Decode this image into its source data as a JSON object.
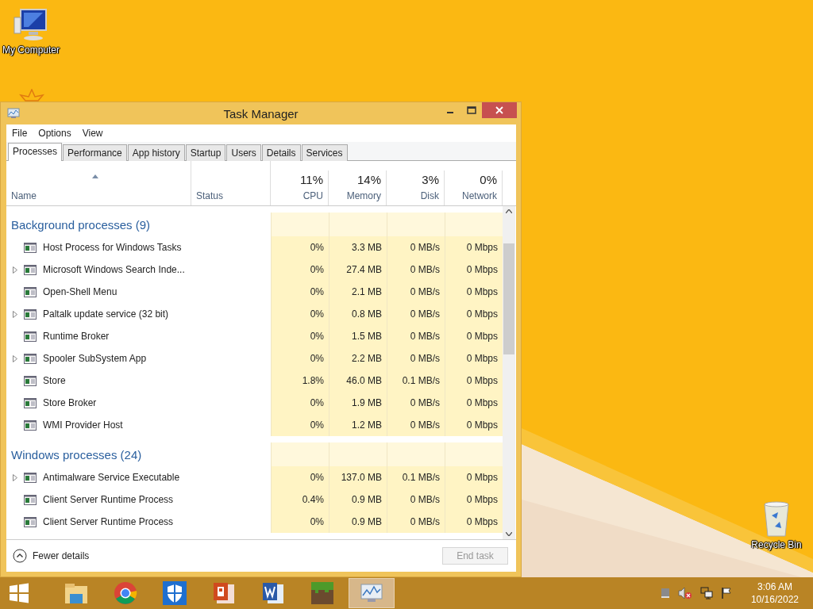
{
  "desktop_icons": [
    {
      "label": "My Computer"
    },
    {
      "label": "Recycle Bin"
    }
  ],
  "window": {
    "title": "Task Manager",
    "menu": [
      "File",
      "Options",
      "View"
    ],
    "tabs": [
      {
        "label": "Processes",
        "selected": true
      },
      {
        "label": "Performance",
        "selected": false
      },
      {
        "label": "App history",
        "selected": false
      },
      {
        "label": "Startup",
        "selected": false
      },
      {
        "label": "Users",
        "selected": false
      },
      {
        "label": "Details",
        "selected": false
      },
      {
        "label": "Services",
        "selected": false
      }
    ],
    "columns": {
      "name": "Name",
      "status": "Status",
      "metrics": [
        {
          "percent": "11%",
          "label": "CPU"
        },
        {
          "percent": "14%",
          "label": "Memory"
        },
        {
          "percent": "3%",
          "label": "Disk"
        },
        {
          "percent": "0%",
          "label": "Network"
        }
      ]
    },
    "groups": [
      {
        "title": "Background processes (9)",
        "rows": [
          {
            "name": "Host Process for Windows Tasks",
            "expandable": false,
            "values": [
              "0%",
              "3.3 MB",
              "0 MB/s",
              "0 Mbps"
            ]
          },
          {
            "name": "Microsoft Windows Search Inde...",
            "expandable": true,
            "values": [
              "0%",
              "27.4 MB",
              "0 MB/s",
              "0 Mbps"
            ]
          },
          {
            "name": "Open-Shell Menu",
            "expandable": false,
            "values": [
              "0%",
              "2.1 MB",
              "0 MB/s",
              "0 Mbps"
            ]
          },
          {
            "name": "Paltalk update service (32 bit)",
            "expandable": true,
            "values": [
              "0%",
              "0.8 MB",
              "0 MB/s",
              "0 Mbps"
            ]
          },
          {
            "name": "Runtime Broker",
            "expandable": false,
            "values": [
              "0%",
              "1.5 MB",
              "0 MB/s",
              "0 Mbps"
            ]
          },
          {
            "name": "Spooler SubSystem App",
            "expandable": true,
            "values": [
              "0%",
              "2.2 MB",
              "0 MB/s",
              "0 Mbps"
            ]
          },
          {
            "name": "Store",
            "expandable": false,
            "values": [
              "1.8%",
              "46.0 MB",
              "0.1 MB/s",
              "0 Mbps"
            ]
          },
          {
            "name": "Store Broker",
            "expandable": false,
            "values": [
              "0%",
              "1.9 MB",
              "0 MB/s",
              "0 Mbps"
            ]
          },
          {
            "name": "WMI Provider Host",
            "expandable": false,
            "values": [
              "0%",
              "1.2 MB",
              "0 MB/s",
              "0 Mbps"
            ]
          }
        ]
      },
      {
        "title": "Windows processes (24)",
        "rows": [
          {
            "name": "Antimalware Service Executable",
            "expandable": true,
            "values": [
              "0%",
              "137.0 MB",
              "0.1 MB/s",
              "0 Mbps"
            ]
          },
          {
            "name": "Client Server Runtime Process",
            "expandable": false,
            "values": [
              "0.4%",
              "0.9 MB",
              "0 MB/s",
              "0 Mbps"
            ]
          },
          {
            "name": "Client Server Runtime Process",
            "expandable": false,
            "values": [
              "0%",
              "0.9 MB",
              "0 MB/s",
              "0 Mbps"
            ]
          }
        ]
      }
    ],
    "fewer_details": "Fewer details",
    "end_task": {
      "label": "End task",
      "disabled": true
    }
  },
  "taskbar": {
    "apps": [
      {
        "selected": false
      },
      {
        "selected": false
      },
      {
        "selected": false
      },
      {
        "selected": false
      },
      {
        "selected": false
      },
      {
        "selected": false
      },
      {
        "selected": true
      }
    ],
    "clock": {
      "time": "3:06 AM",
      "date": "10/16/2022"
    }
  }
}
